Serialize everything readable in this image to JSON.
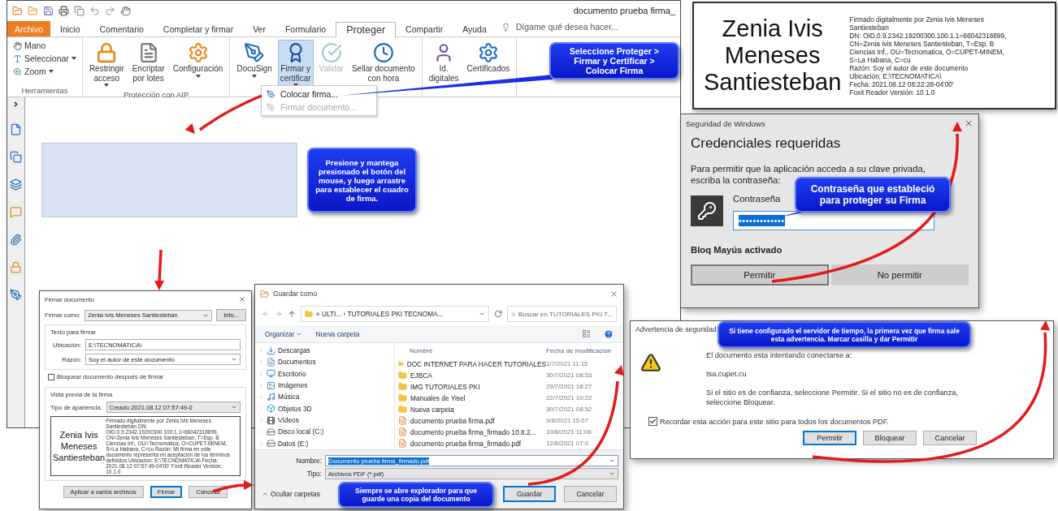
{
  "foxit_window": {
    "title": "documento prueba firma_",
    "tabs": [
      {
        "label": "Archivo",
        "kind": "file",
        "selected": false
      },
      {
        "label": "Inicio",
        "kind": "tab",
        "selected": false
      },
      {
        "label": "Comentario",
        "kind": "tab",
        "selected": false
      },
      {
        "label": "Completar y firmar",
        "kind": "tab",
        "selected": false
      },
      {
        "label": "Ver",
        "kind": "tab",
        "selected": false
      },
      {
        "label": "Formulario",
        "kind": "tab",
        "selected": false
      },
      {
        "label": "Proteger",
        "kind": "tab",
        "selected": true
      },
      {
        "label": "Compartir",
        "kind": "tab",
        "selected": false
      },
      {
        "label": "Ayuda",
        "kind": "tab",
        "selected": false
      }
    ],
    "tell_me": "Dígame qué desea hacer...",
    "ribbon_groups": [
      {
        "label": "Herramientas",
        "items": [
          {
            "kind": "small",
            "lines": [
              "Mano"
            ],
            "dropdown": false,
            "selected": false,
            "disabled": false
          },
          {
            "kind": "small",
            "lines": [
              "Seleccionar"
            ],
            "dropdown": true,
            "selected": false,
            "disabled": false
          },
          {
            "kind": "small",
            "lines": [
              "Zoom"
            ],
            "dropdown": true,
            "selected": false,
            "disabled": false
          }
        ]
      },
      {
        "label": "Protección con AIP",
        "items": [
          {
            "kind": "large",
            "lines": [
              "Restringir",
              "acceso"
            ],
            "dropdown": true,
            "selected": false,
            "disabled": false
          },
          {
            "kind": "large",
            "lines": [
              "Encriptar",
              "por lotes"
            ],
            "dropdown": false,
            "selected": false,
            "disabled": false
          },
          {
            "kind": "large",
            "lines": [
              "Configuración"
            ],
            "dropdown": true,
            "selected": false,
            "disabled": false
          }
        ]
      },
      {
        "items": [
          {
            "kind": "large",
            "lines": [
              "DocuSign"
            ],
            "dropdown": true,
            "selected": false,
            "disabled": false
          },
          {
            "kind": "large",
            "lines": [
              "Firmar y",
              "certificar"
            ],
            "dropdown": true,
            "selected": true,
            "disabled": false
          },
          {
            "kind": "large",
            "lines": [
              "Validar"
            ],
            "dropdown": false,
            "selected": false,
            "disabled": true
          },
          {
            "kind": "large",
            "lines": [
              "Sellar documento",
              "con hora"
            ],
            "dropdown": false,
            "selected": false,
            "disabled": false
          }
        ]
      },
      {
        "items": [
          {
            "kind": "large",
            "lines": [
              "Id.",
              "digitales"
            ],
            "dropdown": false,
            "selected": false,
            "disabled": false
          },
          {
            "kind": "large",
            "lines": [
              "Certificados"
            ],
            "dropdown": false,
            "selected": false,
            "disabled": false
          }
        ]
      }
    ],
    "menu": [
      {
        "label": "Colocar firma...",
        "disabled": false
      },
      {
        "label": "Firmar documento...",
        "disabled": true
      }
    ]
  },
  "signature_preview": {
    "name_lines": [
      "Zenia Ivis",
      "Meneses",
      "Santiesteban"
    ],
    "details": [
      "Firmado digitalmente por Zenia Ivis Meneses",
      "Santiesteban",
      "DN: OID.0.9.2342.19200300.100.1.1=66042318899,",
      "CN=Zenia Ivis Meneses Santiesteban, T=Esp. B",
      "Ciencias Inf., OU=Tecnomatica, O=CUPET-MINEM,",
      "S=La Habana, C=cu",
      "Razón: Soy el autor de este documento",
      "Ubicación: E:\\TECNOMATICA\\",
      "Fecha: 2021.08.12 08:22:28-04'00'",
      "Foxit Reader Versión: 10.1.0"
    ]
  },
  "credentials_dialog": {
    "title": "Seguridad de Windows",
    "heading": "Credenciales requeridas",
    "message": "Para permitir que la aplicación acceda a su clave privada, escriba la contraseña:",
    "password_label": "Contraseña",
    "password_value": "•••••••••••••",
    "caps_warning": "Bloq Mayús activado",
    "buttons": [
      {
        "label": "Permitir",
        "selected": true
      },
      {
        "label": "No permitir",
        "selected": false
      }
    ]
  },
  "sign_dialog": {
    "title": "Firmar documento",
    "sign_as_label": "Firmar como:",
    "sign_as_value": "Zenia Ivis Meneses Santiesteban",
    "info_button": "Info...",
    "text_group": "Texto para firmar",
    "location_label": "Ubicación:",
    "location_value": "E:\\TECNOMATICA\\",
    "reason_label": "Razón:",
    "reason_value": "Soy el autor de este documento",
    "lock_label": "Bloquear documento después de firmar",
    "lock_checked": false,
    "preview_group": "Vista previa de la firma",
    "appearance_label": "Tipo de apariencia:",
    "appearance_value": "Creado 2021.08.12 07:57:49-0",
    "preview_name_lines": [
      "Zenia Ivis",
      "Meneses",
      "Santiesteban"
    ],
    "preview_details": "Firmado digitalmente por Zenia Ivis Meneses Santiesteban DN: OID.0.9.2342.19200300.100.1.1=66042318899, CN=Zenia Ivis Meneses Santiesteban, T=Esp. B Ciencias Inf., OU=Tecnomatica, O=CUPET-MINEM, S=La Habana, C=cu Razón: Mi firma en este documento representa mi aceptación de los términos definidos Ubicación: E:\\TECNOMATICA\\ Fecha: 2021.08.12 07:57:49-04'00' Foxit Reader Versión: 10.1.0",
    "buttons": [
      {
        "label": "Aplicar a varios archivos",
        "selected": false
      },
      {
        "label": "Firmar",
        "selected": true
      },
      {
        "label": "Cancelar",
        "selected": false
      }
    ]
  },
  "save_dialog": {
    "title": "Guardar como",
    "path": "« ULTI... › TUTORIALES PKI TECNOMA...",
    "search_placeholder": "Buscar en TUTORIALES PKI T...",
    "organize": "Organizar",
    "new_folder": "Nueva carpeta",
    "nav_items": [
      {
        "label": "Descargas"
      },
      {
        "label": "Documentos"
      },
      {
        "label": "Escritorio"
      },
      {
        "label": "Imágenes"
      },
      {
        "label": "Música"
      },
      {
        "label": "Objetos 3D"
      },
      {
        "label": "Vídeos"
      },
      {
        "label": "Disco local (C:)"
      },
      {
        "label": "Datos (E:)"
      }
    ],
    "columns": [
      "Nombre",
      "Fecha de modificación"
    ],
    "rows": [
      {
        "kind": "folder",
        "name": "DOC INTERNET PARA HACER TUTORIALES",
        "date": "1/7/2021 11:15"
      },
      {
        "kind": "folder",
        "name": "EJBCA",
        "date": "30/7/2021 08:53"
      },
      {
        "kind": "folder",
        "name": "IMG TUTORIALES PKI",
        "date": "29/7/2021 18:27"
      },
      {
        "kind": "folder",
        "name": "Manuales de Yisel",
        "date": "22/7/2021 10:22"
      },
      {
        "kind": "folder",
        "name": "Nueva carpeta",
        "date": "30/7/2021 08:52"
      },
      {
        "kind": "pdf",
        "name": "documento prueba firma.pdf",
        "date": "9/8/2021 15:07"
      },
      {
        "kind": "pdf",
        "name": "documento prueba firma_firmado 10.8.2...",
        "date": "10/8/2021 11:06"
      },
      {
        "kind": "pdf",
        "name": "documento prueba firma_firmado.pdf",
        "date": "12/8/2021 07:0"
      }
    ],
    "name_label": "Nombre:",
    "name_value": "Documento prueba firma_firmado.pdf",
    "type_label": "Tipo:",
    "type_value": "Archivos PDF (*.pdf)",
    "hide_folders": "Ocultar carpetas",
    "buttons": [
      {
        "label": "Guardar",
        "selected": true
      },
      {
        "label": "Cancelar",
        "selected": false
      }
    ]
  },
  "warning_dialog": {
    "title": "Advertencia de seguridad",
    "intro": "El documento esta intentando conectarse a:",
    "host": "tsa.cupet.cu",
    "advice": "Si el sitio es de confianza, seleccione Permitir. Si el sitio no es de confianza, seleccione Bloquear.",
    "remember_label": "Recordar esta acción para este sitio para todos los documentos PDF.",
    "remember_checked": true,
    "buttons": [
      {
        "label": "Permitir",
        "selected": true
      },
      {
        "label": "Bloquear",
        "selected": false
      },
      {
        "label": "Cancelar",
        "selected": false
      }
    ]
  },
  "callouts": [
    {
      "text": "Seleccione Proteger > Firmar y Certificar > Colocar Firma"
    },
    {
      "text": "Presione y mantega presionado el botón del mouse, y luego arrastre para establecer el cuadro de firma."
    },
    {
      "text": "Contraseña que estableció para  proteger su Firma"
    },
    {
      "text": "Siempre se abre explorador para que guarde una copia del documento"
    },
    {
      "text": "Si tiene configurado el servidor de tiempo, la primera vez que firma sale esta advertencia. Marcar casilla y dar Permitir"
    }
  ]
}
